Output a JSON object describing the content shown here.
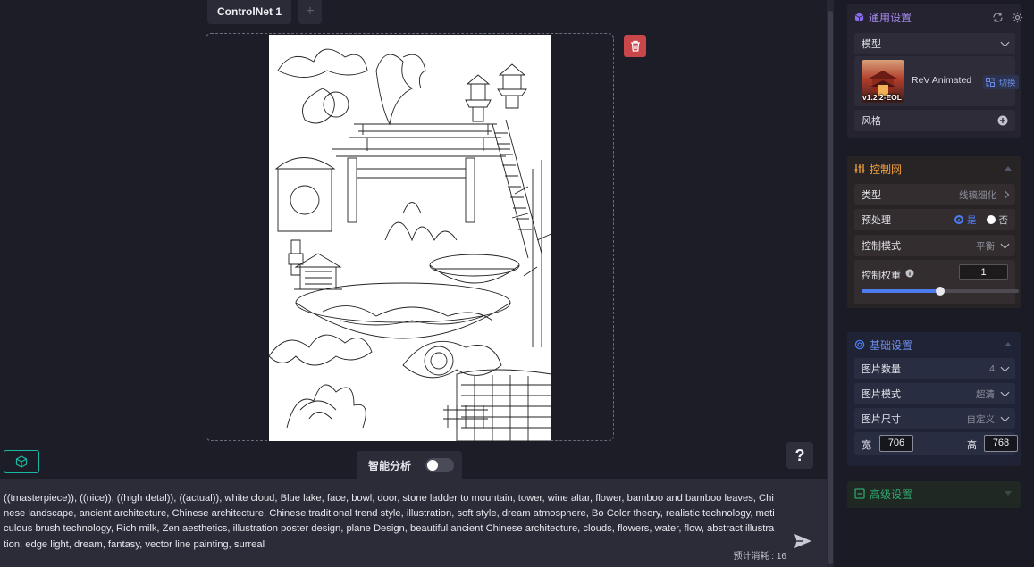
{
  "tabs": {
    "active_label": "ControlNet 1",
    "add_label": "+"
  },
  "canvas": {
    "smart_analysis_label": "智能分析",
    "help_label": "?"
  },
  "prompt": {
    "text": "((tmasterpiece)), ((nice)), ((high detal)), ((actual)), white cloud, Blue lake, face, bowl, door, stone ladder to mountain, tower, wine altar, flower, bamboo and bamboo leaves, Chinese landscape, ancient architecture, Chinese architecture, Chinese traditional trend style, illustration, soft style, dream atmosphere, Bo Color theory, realistic technology, meticulous brush technology, Rich milk, Zen aesthetics, illustration poster design, plane Design, beautiful ancient Chinese architecture, clouds, flowers, water, flow, abstract illustration, edge light, dream, fantasy, vector line painting, surreal",
    "cost_label": "预计消耗 : 16"
  },
  "general": {
    "title": "通用设置",
    "model_label": "模型",
    "model_name": "ReV Animated",
    "model_version": "v1.2.2-EOL",
    "switch_label": "切换",
    "style_label": "风格"
  },
  "controlnet": {
    "title": "控制网",
    "type_label": "类型",
    "type_value": "线稿细化",
    "preprocess_label": "预处理",
    "preprocess_yes": "是",
    "preprocess_no": "否",
    "mode_label": "控制模式",
    "mode_value": "平衡",
    "weight_label": "控制权重",
    "weight_value": "1",
    "weight_fraction": 0.5
  },
  "basic": {
    "title": "基础设置",
    "count_label": "图片数量",
    "count_value": "4",
    "quality_label": "图片模式",
    "quality_value": "超清",
    "size_label": "图片尺寸",
    "size_value": "自定义",
    "width_label": "宽",
    "width_value": "706",
    "height_label": "高",
    "height_value": "768"
  },
  "advanced": {
    "title": "高级设置"
  },
  "colors": {
    "purple": "#8a6cf0",
    "orange": "#f0a040",
    "blue": "#4c7cf0",
    "green": "#2fa36b",
    "delete_red": "#c9474a",
    "teal": "#1bb9a4"
  }
}
